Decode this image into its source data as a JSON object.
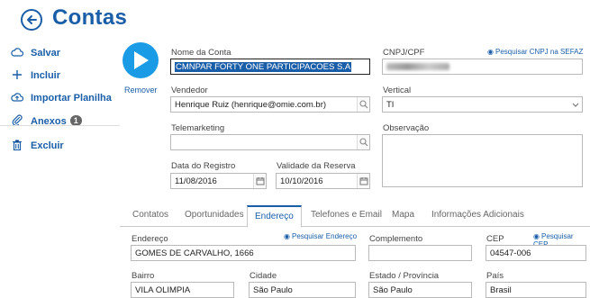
{
  "header": {
    "title": "Contas",
    "back_icon": "back-arrow-icon"
  },
  "sidebar": {
    "items": [
      {
        "label": "Salvar",
        "icon": "cloud-icon"
      },
      {
        "label": "Incluir",
        "icon": "plus-icon"
      },
      {
        "label": "Importar Planilha",
        "icon": "cloud-upload-icon"
      },
      {
        "label": "Anexos",
        "icon": "paperclip-icon",
        "badge": "1"
      },
      {
        "label": "Excluir",
        "icon": "trash-icon"
      }
    ]
  },
  "avatar": {
    "remove_label": "Remover",
    "color": "#1a9be6"
  },
  "form": {
    "nome_label": "Nome da Conta",
    "nome_value": "CMNPAR FORTY ONE PARTICIPACOES S.A",
    "cnpj_label": "CNPJ/CPF",
    "cnpj_link": "Pesquisar CNPJ na SEFAZ",
    "vendedor_label": "Vendedor",
    "vendedor_value": "Henrique Ruiz (henrique@omie.com.br)",
    "vertical_label": "Vertical",
    "vertical_value": "TI",
    "telemarketing_label": "Telemarketing",
    "telemarketing_value": "",
    "observacao_label": "Observação",
    "data_registro_label": "Data do Registro",
    "data_registro_value": "11/08/2016",
    "validade_label": "Validade da Reserva",
    "validade_value": "10/10/2016"
  },
  "tabs": [
    "Contatos",
    "Oportunidades",
    "Endereço",
    "Telefones e Email",
    "Mapa",
    "Informações Adicionais"
  ],
  "address": {
    "endereco_label": "Endereço",
    "endereco_link": "Pesquisar Endereço",
    "endereco_value": "GOMES DE CARVALHO, 1666",
    "complemento_label": "Complemento",
    "complemento_value": "",
    "cep_label": "CEP",
    "cep_link": "Pesquisar CEP",
    "cep_value": "04547-006",
    "bairro_label": "Bairro",
    "bairro_value": "VILA OLIMPIA",
    "cidade_label": "Cidade",
    "cidade_value": "São Paulo",
    "estado_label": "Estado / Província",
    "estado_value": "São Paulo",
    "pais_label": "País",
    "pais_value": "Brasil"
  },
  "colors": {
    "accent": "#1a5ea8",
    "selection": "#1a5ea8"
  }
}
